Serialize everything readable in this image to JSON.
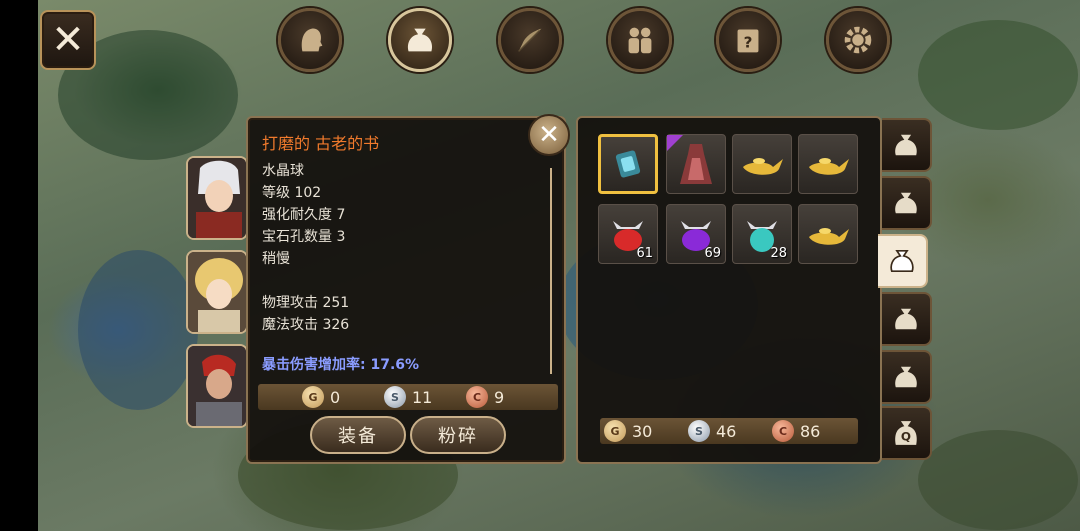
{
  "top_tabs": [
    {
      "icon": "head-icon",
      "active": false
    },
    {
      "icon": "bag-icon",
      "active": true
    },
    {
      "icon": "feather-icon",
      "active": false
    },
    {
      "icon": "party-icon",
      "active": false
    },
    {
      "icon": "quest-scroll-icon",
      "active": false
    },
    {
      "icon": "gear-icon",
      "active": false
    }
  ],
  "close_icon": "close-icon",
  "detail": {
    "title": "打磨的 古老的书",
    "stats": [
      "水晶球",
      "等级 102",
      "强化耐久度 7",
      "宝石孔数量 3",
      "稍慢",
      "",
      "物理攻击 251",
      "魔法攻击 326"
    ],
    "crit": "暴击伤害增加率: 17.6%",
    "price": {
      "gold": "0",
      "silver": "11",
      "copper": "9"
    },
    "equip_label": "装备",
    "smash_label": "粉碎"
  },
  "inventory": {
    "slots": [
      {
        "icon": "crystal-book-icon",
        "qty": "",
        "selected": true
      },
      {
        "icon": "dress-armor-icon",
        "qty": "",
        "rare": true
      },
      {
        "icon": "magic-lamp-icon",
        "qty": ""
      },
      {
        "icon": "magic-lamp-icon",
        "qty": ""
      },
      {
        "icon": "red-potion-icon",
        "qty": "61"
      },
      {
        "icon": "purple-potion-icon",
        "qty": "69"
      },
      {
        "icon": "cyan-potion-icon",
        "qty": "28"
      },
      {
        "icon": "magic-lamp-icon",
        "qty": ""
      }
    ],
    "money": {
      "gold": "30",
      "silver": "46",
      "copper": "86"
    }
  },
  "bag_tabs": [
    {
      "icon": "bag-icon",
      "active": false
    },
    {
      "icon": "bag-icon",
      "active": false
    },
    {
      "icon": "bag-icon",
      "active": true
    },
    {
      "icon": "bag-icon",
      "active": false
    },
    {
      "icon": "bag-icon",
      "active": false
    },
    {
      "icon": "quest-bag-icon",
      "active": false,
      "label": "Q"
    }
  ],
  "colors": {
    "title_orange": "#f07a2c",
    "crit_blue": "#8a9cff",
    "frame_gold": "#cbb28a",
    "select_yellow": "#f0c040"
  }
}
